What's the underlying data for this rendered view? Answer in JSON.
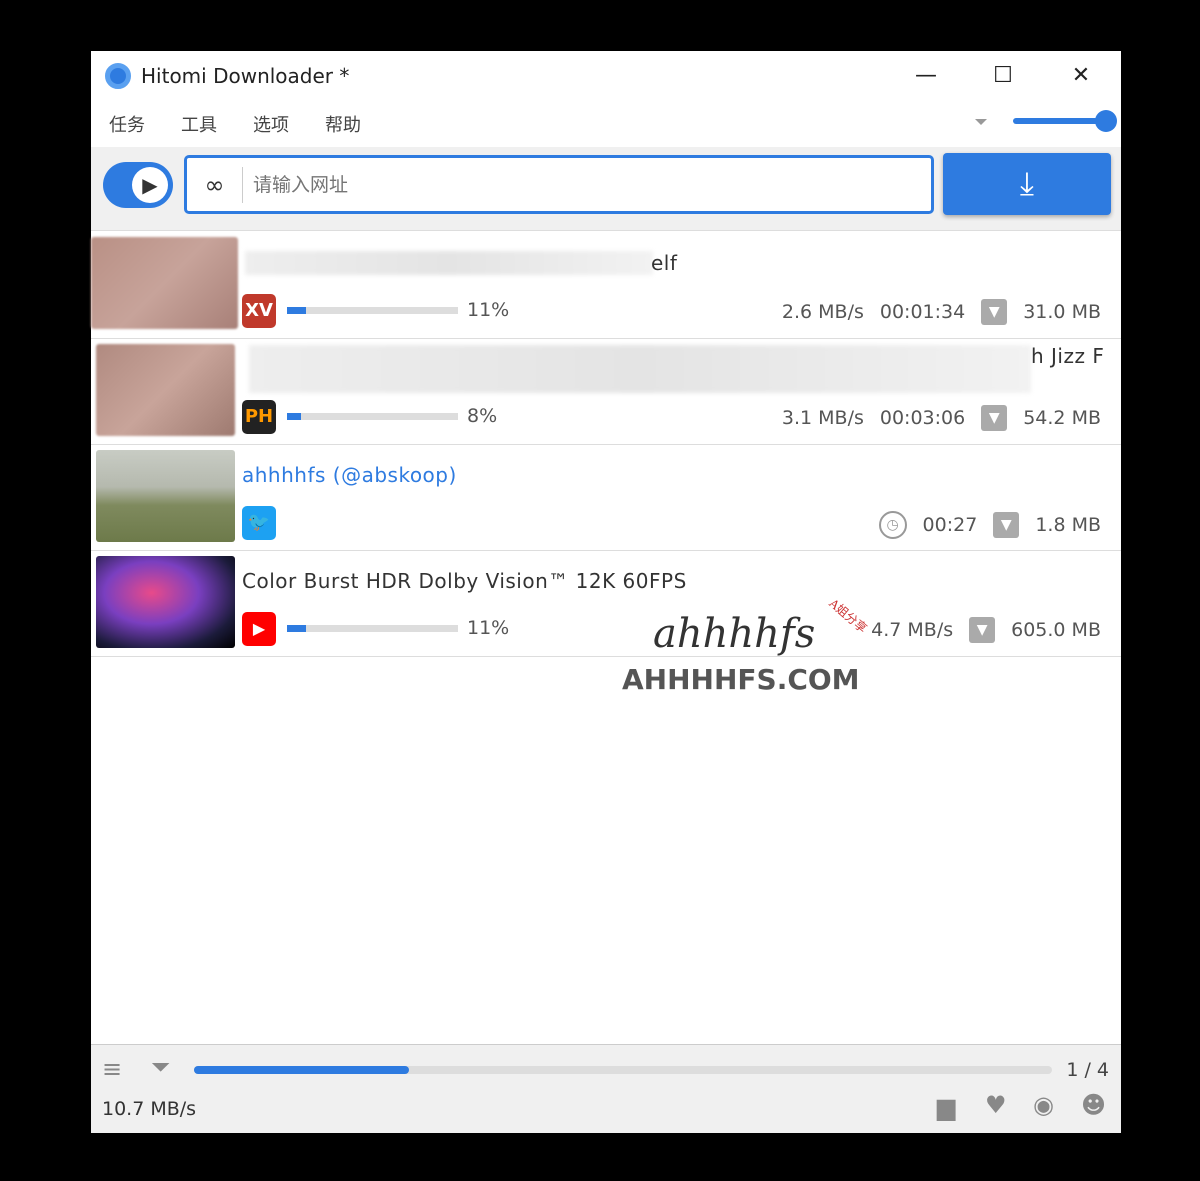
{
  "window": {
    "title": "Hitomi Downloader *",
    "minimize": "—",
    "maximize": "☐",
    "close": "✕"
  },
  "menu": [
    "任务",
    "工具",
    "选项",
    "帮助"
  ],
  "volume_level": 1.0,
  "toolbar": {
    "url_placeholder": "请输入网址",
    "url_value": "",
    "play_icon": "▶",
    "link_icon": "🔗",
    "download_icon": "⤓"
  },
  "tasks": [
    {
      "title_visible": "elf",
      "site": "XV",
      "site_color": "#c0392b",
      "progress_pct": 11,
      "progress_label": "11%",
      "speed": "2.6 MB/s",
      "eta": "00:01:34",
      "size": "31.0 MB"
    },
    {
      "title_visible": "h Jizz F",
      "site": "PH",
      "site_color": "#222222",
      "progress_pct": 8,
      "progress_label": "8%",
      "speed": "3.1 MB/s",
      "eta": "00:03:06",
      "size": "54.2 MB"
    },
    {
      "title_visible": "ahhhhfs (@abskoop)",
      "site": "twitter",
      "site_color": "#1da1f2",
      "eta": "00:27",
      "size": "1.8 MB"
    },
    {
      "title_visible": "Color Burst HDR Dolby Vision™ 12K 60FPS",
      "site": "youtube",
      "site_color": "#ff0000",
      "progress_pct": 11,
      "progress_label": "11%",
      "speed": "4.7 MB/s",
      "size": "605.0 MB"
    }
  ],
  "status": {
    "overall_progress_pct": 25,
    "count": "1 / 4",
    "total_speed": "10.7 MB/s"
  },
  "watermark": {
    "logo": "ahhhhfs",
    "tag": "A姐分享",
    "site": "AHHHHFS.COM"
  },
  "colors": {
    "accent": "#2e7be0"
  }
}
